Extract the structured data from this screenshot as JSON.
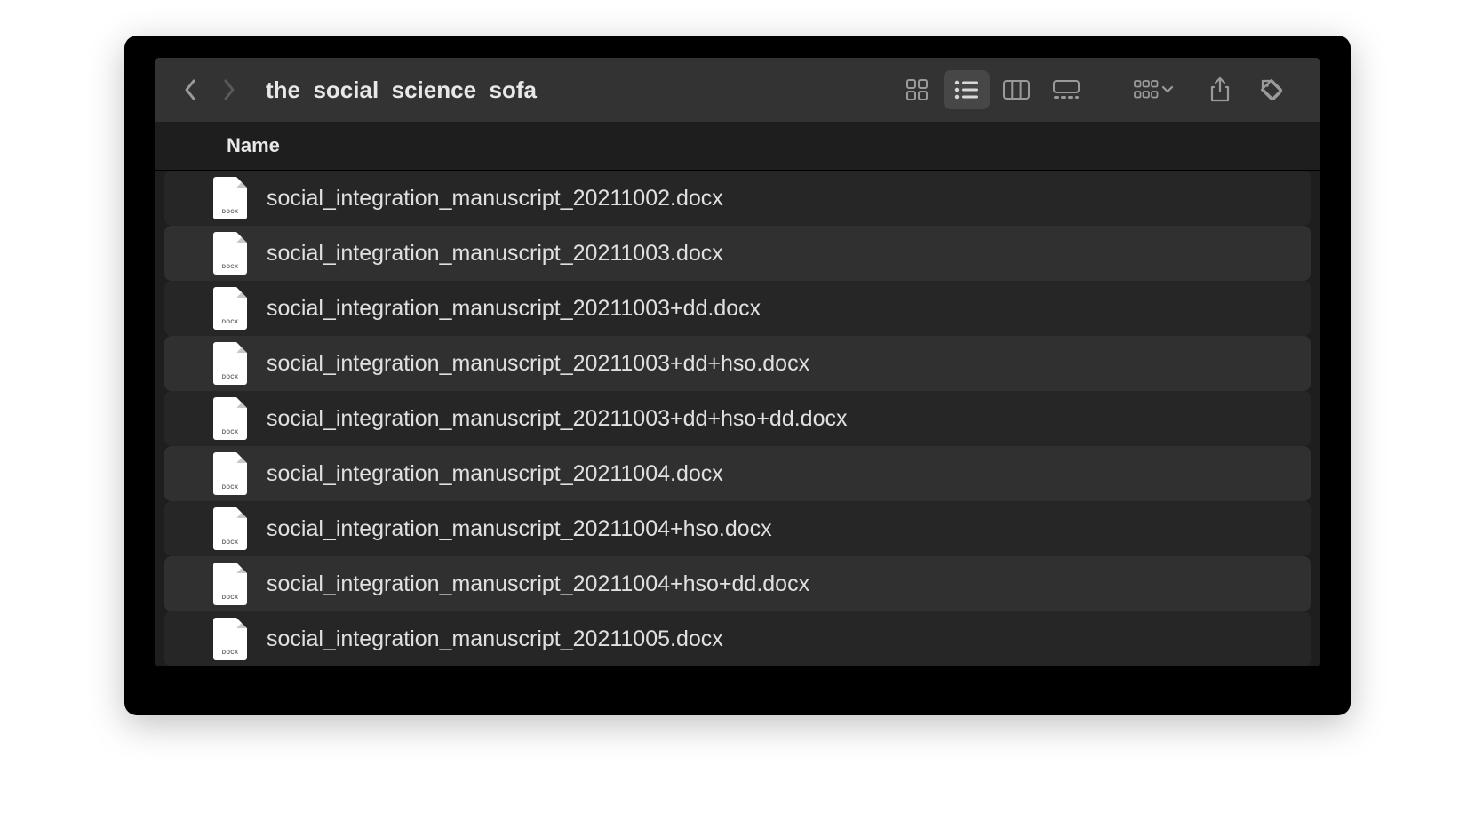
{
  "toolbar": {
    "folder_title": "the_social_science_sofa"
  },
  "columns": {
    "name": "Name"
  },
  "icon_label": "DOCX",
  "files": [
    {
      "name": "social_integration_manuscript_20211002.docx"
    },
    {
      "name": "social_integration_manuscript_20211003.docx"
    },
    {
      "name": "social_integration_manuscript_20211003+dd.docx"
    },
    {
      "name": "social_integration_manuscript_20211003+dd+hso.docx"
    },
    {
      "name": "social_integration_manuscript_20211003+dd+hso+dd.docx"
    },
    {
      "name": "social_integration_manuscript_20211004.docx"
    },
    {
      "name": "social_integration_manuscript_20211004+hso.docx"
    },
    {
      "name": "social_integration_manuscript_20211004+hso+dd.docx"
    },
    {
      "name": "social_integration_manuscript_20211005.docx"
    }
  ]
}
